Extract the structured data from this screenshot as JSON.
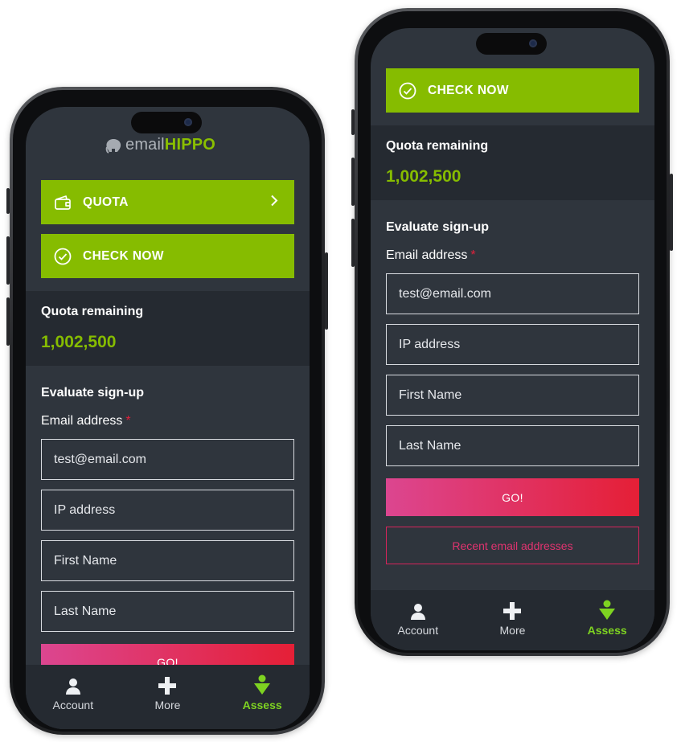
{
  "logo": {
    "prefix": "email",
    "suffix": "HIPPO"
  },
  "quota_button": {
    "label": "QUOTA"
  },
  "check_button": {
    "label": "CHECK NOW"
  },
  "quota_panel": {
    "label": "Quota remaining",
    "value": "1,002,500"
  },
  "form": {
    "title": "Evaluate sign-up",
    "email_label": "Email address",
    "required_mark": "*",
    "email_value": "test@email.com",
    "ip_placeholder": "IP address",
    "first_name_placeholder": "First Name",
    "last_name_placeholder": "Last Name",
    "go_label": "GO!",
    "recent_label": "Recent email addresses"
  },
  "tabs": [
    {
      "label": "Account",
      "icon": "account-icon",
      "active": false
    },
    {
      "label": "More",
      "icon": "plus-icon",
      "active": false
    },
    {
      "label": "Assess",
      "icon": "assess-icon",
      "active": true
    }
  ],
  "colors": {
    "accent_green": "#86bc00",
    "go_gradient_start": "#dc4690",
    "go_gradient_end": "#e51f36",
    "screen_bg": "#2f353d",
    "panel_bg": "#252a31"
  }
}
